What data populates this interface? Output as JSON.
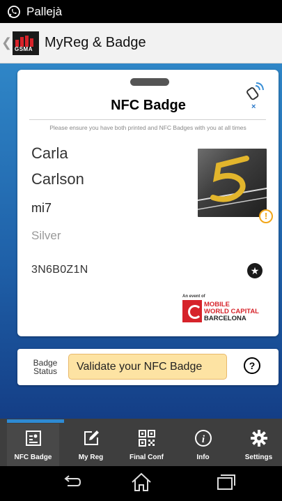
{
  "status_bar": {
    "app_icon": "whatsapp-icon",
    "text": "Pallejà"
  },
  "action_bar": {
    "back_icon": "back-caret-icon",
    "logo_text": "GSMA",
    "title": "MyReg & Badge"
  },
  "badge_card": {
    "title": "NFC Badge",
    "nfc_icon": "nfc-tag-icon",
    "nfc_close": "×",
    "note": "Please ensure you have both printed and NFC Badges with you at all times",
    "first_name": "Carla",
    "last_name": "Carlson",
    "company": "mi7",
    "tier": "Silver",
    "code": "3N6B0Z1N",
    "warning_icon": "!",
    "star_icon": "★",
    "event_of": "An event of",
    "event_logo_lines": [
      "MOBILE",
      "WORLD CAPITAL",
      "BARCELONA"
    ]
  },
  "badge_status": {
    "label_line1": "Badge",
    "label_line2": "Status",
    "button": "Validate your NFC Badge",
    "help": "?"
  },
  "bottom_nav": [
    {
      "label": "NFC Badge",
      "icon": "badge-icon",
      "active": true
    },
    {
      "label": "My Reg",
      "icon": "edit-icon",
      "active": false
    },
    {
      "label": "Final Conf",
      "icon": "qr-code-icon",
      "active": false
    },
    {
      "label": "Info",
      "icon": "info-icon",
      "active": false
    },
    {
      "label": "Settings",
      "icon": "gear-icon",
      "active": false
    }
  ],
  "system_nav": [
    "back-icon",
    "home-icon",
    "recents-icon"
  ],
  "colors": {
    "accent": "#2d8ad3",
    "validate_bg": "#fde3a3",
    "brand_red": "#d6232a",
    "nav_bg": "#3e3e3e"
  }
}
